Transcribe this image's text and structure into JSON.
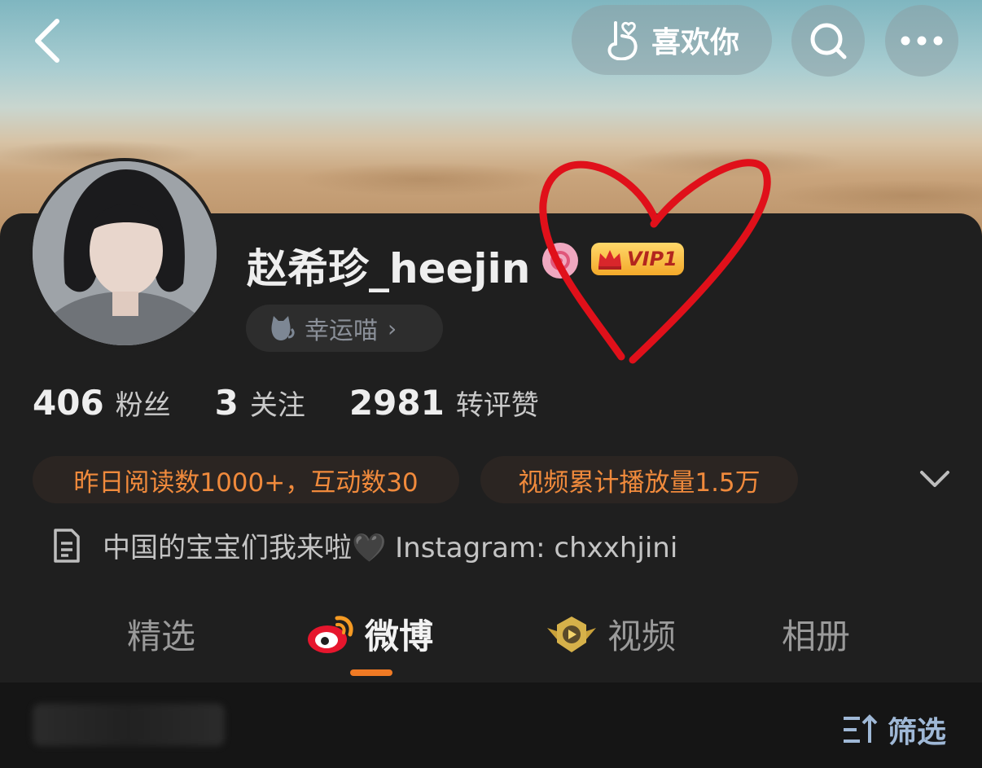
{
  "header": {
    "like_button_label": "喜欢你",
    "icons": [
      "back-icon",
      "hand-heart-icon",
      "search-icon",
      "more-icon"
    ]
  },
  "profile": {
    "username": "赵希珍_heejin",
    "badges": [
      "svip-icon",
      "vip-badge"
    ],
    "vip_label": "VIP1",
    "lucky_chip_label": "幸运喵",
    "lucky_chip_chevron": "›"
  },
  "stats": [
    {
      "value": "406",
      "label": "粉丝"
    },
    {
      "value": "3",
      "label": "关注"
    },
    {
      "value": "2981",
      "label": "转评赞"
    }
  ],
  "chips": [
    "昨日阅读数1000+，互动数30",
    "视频累计播放量1.5万"
  ],
  "bio": {
    "text": "中国的宝宝们我来啦🖤 Instagram: chxxhjini"
  },
  "tabs": [
    {
      "label": "精选",
      "active": false
    },
    {
      "label": "微博",
      "active": true
    },
    {
      "label": "视频",
      "active": false
    },
    {
      "label": "相册",
      "active": false
    }
  ],
  "bottom": {
    "filter_label": "筛选"
  },
  "colors": {
    "accent_orange": "#f07a24",
    "chip_text": "#f08a3c",
    "annotation_heart": "#e0101a",
    "filter_blue": "#9fb8d6"
  }
}
